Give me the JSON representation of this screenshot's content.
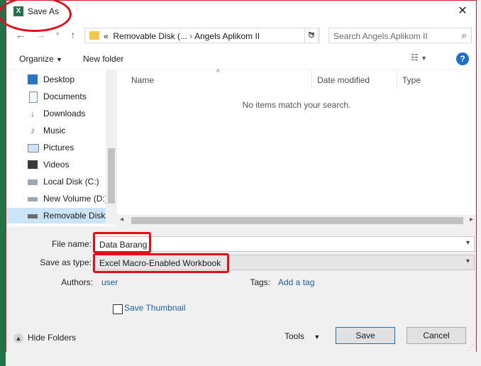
{
  "window": {
    "title": "Save As",
    "app_icon": "X"
  },
  "nav": {
    "address_prefix": "«",
    "address_crumbs": [
      "Removable Disk (...",
      "Angels Aplikom II"
    ],
    "address_sep": "›",
    "search_placeholder": "Search Angels Aplikom II"
  },
  "toolbar": {
    "organize": "Organize",
    "new_folder": "New folder",
    "help": "?"
  },
  "sidebar": {
    "items": [
      {
        "label": "Desktop",
        "icon": "desktop-icon"
      },
      {
        "label": "Documents",
        "icon": "documents-icon"
      },
      {
        "label": "Downloads",
        "icon": "downloads-icon"
      },
      {
        "label": "Music",
        "icon": "music-icon"
      },
      {
        "label": "Pictures",
        "icon": "pictures-icon"
      },
      {
        "label": "Videos",
        "icon": "videos-icon"
      },
      {
        "label": "Local Disk (C:)",
        "icon": "local-disk-icon"
      },
      {
        "label": "New Volume (D:)",
        "icon": "drive-icon"
      },
      {
        "label": "Removable Disk",
        "icon": "usb-drive-icon",
        "selected": true
      }
    ]
  },
  "files": {
    "columns": [
      "Name",
      "Date modified",
      "Type"
    ],
    "empty_message": "No items match your search."
  },
  "form": {
    "file_name_label": "File name:",
    "file_name_value": "Data Barang",
    "save_as_type_label": "Save as type:",
    "save_as_type_value": "Excel Macro-Enabled Workbook",
    "authors_label": "Authors:",
    "authors_value": "user",
    "tags_label": "Tags:",
    "tags_value": "Add a tag",
    "save_thumbnail": "Save Thumbnail",
    "hide_folders": "Hide Folders",
    "tools": "Tools",
    "save": "Save",
    "cancel": "Cancel"
  },
  "colors": {
    "accent": "#0078d7",
    "annotation": "#e0101a",
    "excel_green": "#217346"
  }
}
